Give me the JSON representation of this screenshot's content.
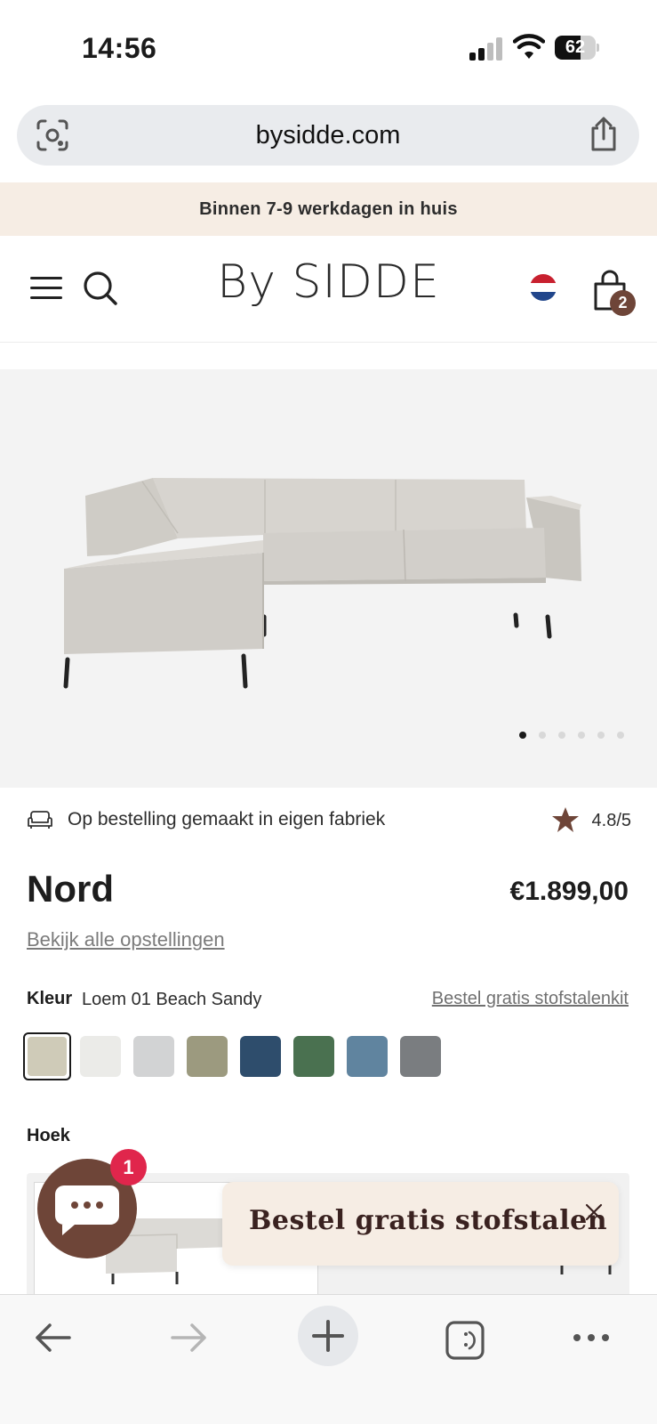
{
  "status_bar": {
    "time": "14:56",
    "battery": "62",
    "battery_level": 0.62
  },
  "url_bar": {
    "url": "bysidde.com"
  },
  "promo": {
    "text": "Binnen 7-9 werkdagen in huis"
  },
  "header": {
    "logo": "By SIDDE",
    "cart_count": "2"
  },
  "hero": {
    "carousel_count": 6,
    "carousel_active": 0
  },
  "product": {
    "info_text": "Op bestelling gemaakt in eigen fabriek",
    "rating": "4.8/5",
    "title": "Nord",
    "price": "€1.899,00",
    "all_configs_link": "Bekijk alle opstellingen",
    "color_label": "Kleur",
    "color_value": "Loem 01 Beach Sandy",
    "sample_kit_link": "Bestel gratis stofstalenkit",
    "swatches": [
      "#cfcbb8",
      "#ebebe8",
      "#d2d3d4",
      "#9c9a7f",
      "#2e4d6c",
      "#4a7150",
      "#60849f",
      "#7a7d80"
    ],
    "selected_swatch": 0,
    "hoek_label": "Hoek"
  },
  "chat": {
    "badge": "1",
    "toast_text": "Bestel gratis stofstalen"
  },
  "colors": {
    "accent_brown": "#6e4538",
    "promo_bg": "#f6ede4",
    "badge_red": "#e0264c"
  }
}
